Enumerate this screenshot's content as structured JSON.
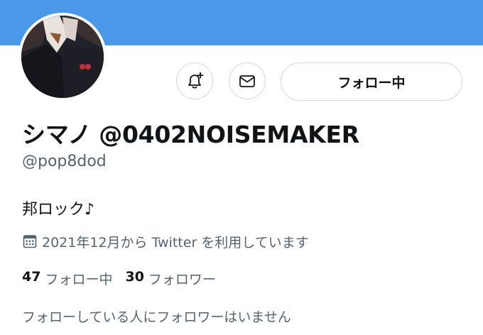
{
  "colors": {
    "banner": "#4a99e9",
    "primary_text": "#0f1419",
    "secondary_text": "#536471",
    "button_border": "#cfd9de"
  },
  "profile": {
    "display_name": "シマノ @0402NOISEMAKER",
    "handle": "@pop8dod",
    "bio": "邦ロック♪",
    "joined": "2021年12月から Twitter を利用しています"
  },
  "actions": {
    "notify_icon": "bell-plus-icon",
    "message_icon": "envelope-icon",
    "follow_label": "フォロー中"
  },
  "stats": {
    "following_count": "47",
    "following_label": "フォロー中",
    "followers_count": "30",
    "followers_label": "フォロワー"
  },
  "followed_by_note": "フォローしている人にフォロワーはいません"
}
